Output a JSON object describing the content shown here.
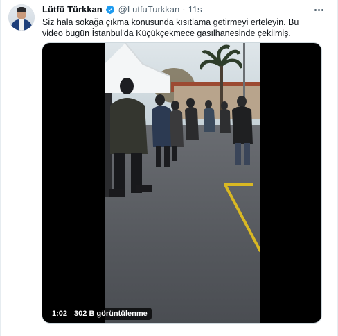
{
  "tweet": {
    "display_name": "Lütfü Türkkan",
    "verified_icon": "verified-badge-icon",
    "handle": "@LutfuTurkkan",
    "separator": "·",
    "time": "11s",
    "more_icon": "more-horizontal-icon",
    "text": "Siz hala sokağa çıkma konusunda kısıtlama getirmeyi erteleyin. Bu video bugün İstanbul'da Küçükçekmece gasılhanesinde çekilmiş."
  },
  "media": {
    "type": "video",
    "duration": "1:02",
    "views": "302 B görüntülenme"
  },
  "colors": {
    "verified_blue": "#1d9bf0",
    "secondary_text": "#536471",
    "border": "#e6ecf0"
  }
}
